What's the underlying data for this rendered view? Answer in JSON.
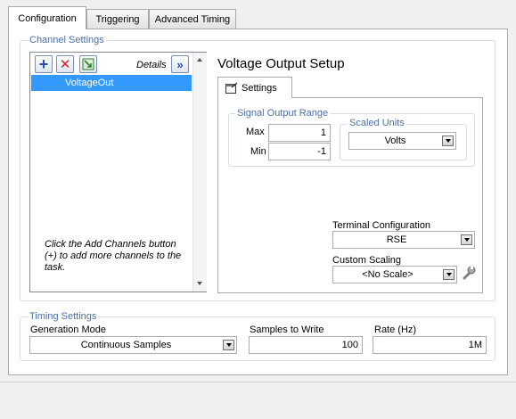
{
  "tabs": [
    {
      "label": "Configuration"
    },
    {
      "label": "Triggering"
    },
    {
      "label": "Advanced Timing"
    }
  ],
  "channel_settings": {
    "title": "Channel Settings",
    "details_label": "Details",
    "channels": [
      "VoltageOut"
    ],
    "hint": "Click the Add Channels button (+) to add more channels to the task."
  },
  "voltage_setup": {
    "title": "Voltage Output Setup",
    "settings_tab": "Settings",
    "signal_range_title": "Signal Output Range",
    "max_label": "Max",
    "max_value": "1",
    "min_label": "Min",
    "min_value": "-1",
    "scaled_units_title": "Scaled Units",
    "scaled_units_value": "Volts",
    "terminal_config_label": "Terminal Configuration",
    "terminal_config_value": "RSE",
    "custom_scaling_label": "Custom Scaling",
    "custom_scaling_value": "<No Scale>"
  },
  "timing": {
    "title": "Timing Settings",
    "generation_mode_label": "Generation Mode",
    "generation_mode_value": "Continuous Samples",
    "samples_label": "Samples to Write",
    "samples_value": "100",
    "rate_label": "Rate (Hz)",
    "rate_value": "1M"
  },
  "colors": {
    "group_title": "#4d6fa3",
    "selection": "#3399ff"
  }
}
